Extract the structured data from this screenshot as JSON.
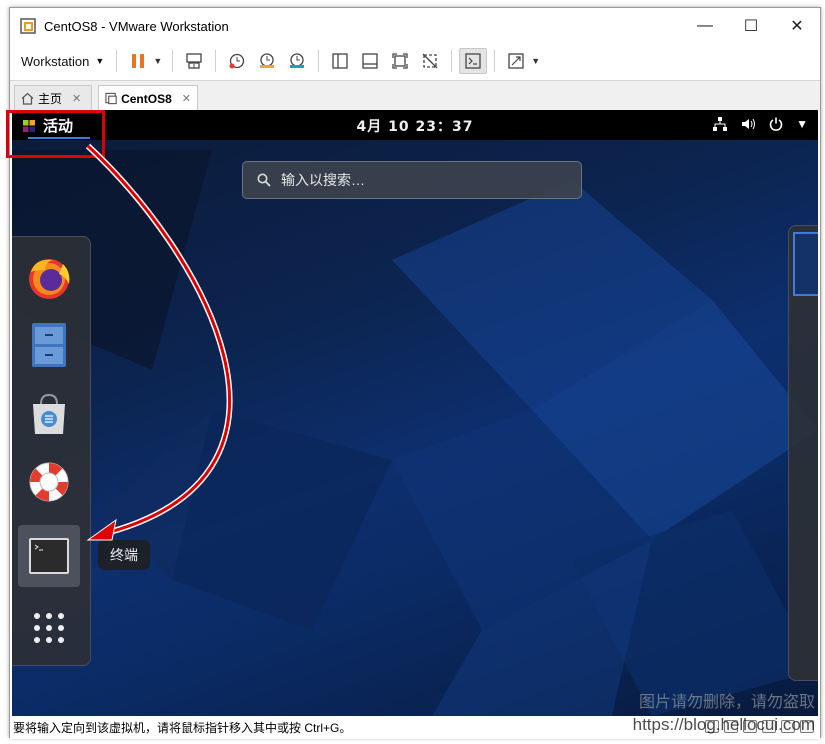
{
  "window": {
    "title": "CentOS8 - VMware Workstation",
    "controls": {
      "minimize": "—",
      "maximize": "☐",
      "close": "✕"
    }
  },
  "toolbar": {
    "menu_label": "Workstation",
    "pause_color": "#e8761c"
  },
  "tabs": [
    {
      "label": "主页",
      "close": "✕"
    },
    {
      "label": "CentOS8",
      "close": "✕"
    }
  ],
  "gnome": {
    "activities": "活动",
    "clock": "4月 10  23：37",
    "search_placeholder": "输入以搜索…",
    "tooltip": "终端",
    "dash_items": [
      "firefox-icon",
      "files-icon",
      "software-icon",
      "help-icon",
      "terminal-icon",
      "show-apps-icon"
    ],
    "accent_color": "#3d7bd8"
  },
  "annotation": {
    "color": "#e00000"
  },
  "statusbar": {
    "text": "要将输入定向到该虚拟机，请将鼠标指针移入其中或按 Ctrl+G。"
  },
  "watermark": {
    "line1": "图片请勿删除，请勿盗取",
    "url": "https://blog.hellocui.com"
  }
}
